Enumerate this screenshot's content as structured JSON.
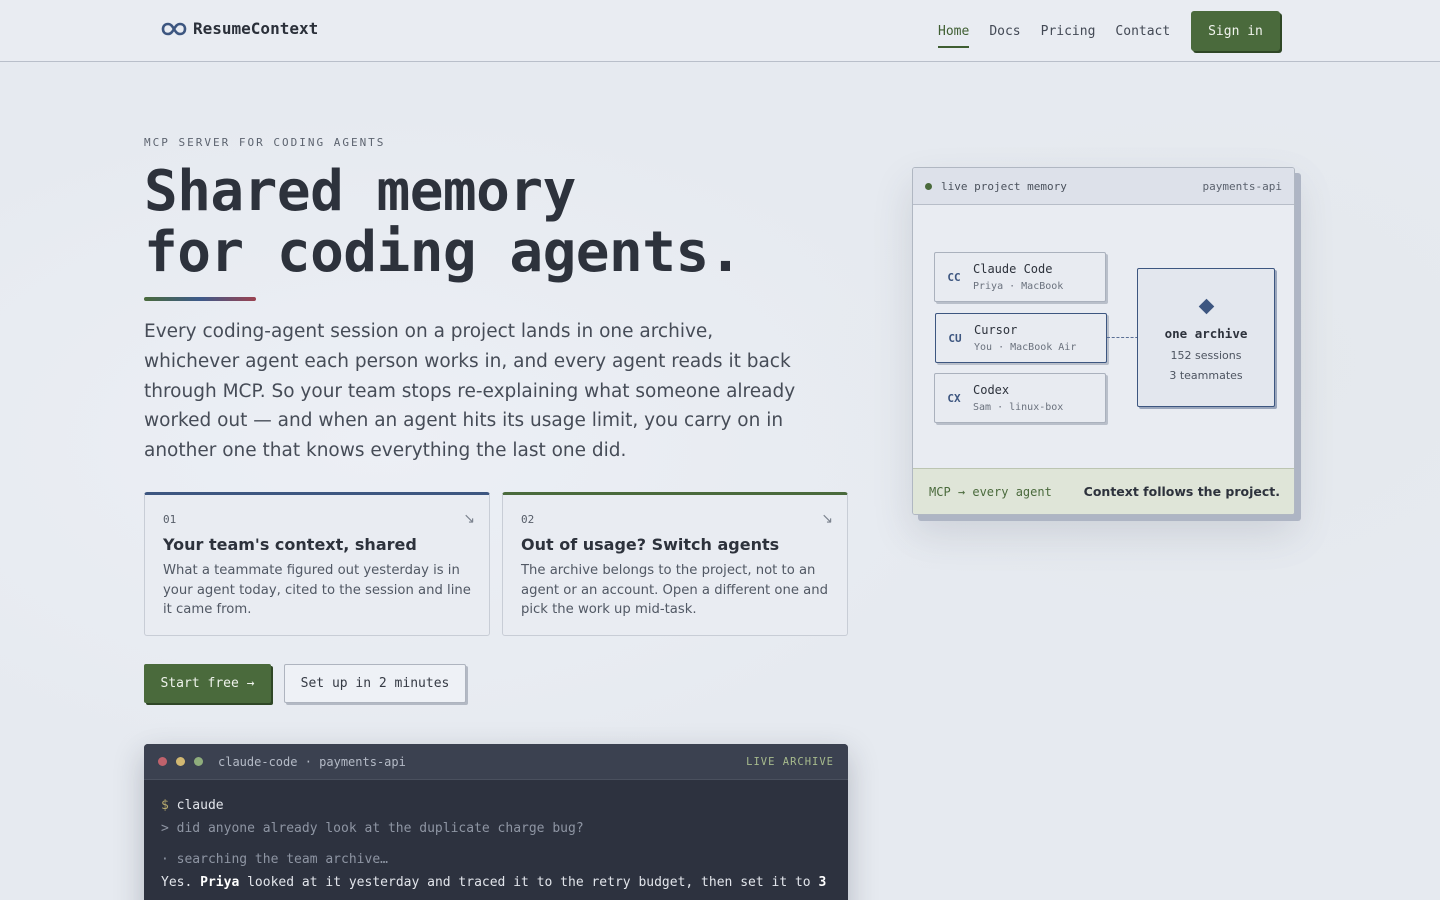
{
  "header": {
    "brand_name": "ResumeContext",
    "nav": [
      {
        "label": "Home",
        "active": true
      },
      {
        "label": "Docs"
      },
      {
        "label": "Pricing"
      },
      {
        "label": "Contact"
      }
    ],
    "signin_label": "Sign in"
  },
  "hero": {
    "eyebrow": "MCP SERVER FOR CODING AGENTS",
    "title_line1": "Shared memory",
    "title_line2": "for coding agents.",
    "lead": "Every coding-agent session on a project lands in one archive, whichever agent each person works in, and every agent reads it back through MCP. So your team stops re-explaining what someone already worked out — and when an agent hits its usage limit, you carry on in another one that knows everything the last one did."
  },
  "features": [
    {
      "num": "01",
      "title": "Your team's context, shared",
      "body": "What a teammate figured out yesterday is in your agent today, cited to the session and line it came from."
    },
    {
      "num": "02",
      "title": "Out of usage? Switch agents",
      "body": "The archive belongs to the project, not to an agent or an account. Open a different one and pick the work up mid-task."
    }
  ],
  "cta": {
    "primary": "Start free →",
    "secondary": "Set up in 2 minutes"
  },
  "terminal": {
    "title": "claude-code · payments-api",
    "badge": "LIVE ARCHIVE",
    "prompt_symbol": "$",
    "command": "claude",
    "question": "> did anyone already look at the duplicate charge bug?",
    "status": "· searching the team archive…",
    "answer_start": "Yes. ",
    "answer_name": "Priya",
    "answer_mid": " looked at it yesterday and traced it to the retry budget, then set it to ",
    "answer_value": "3"
  },
  "panel": {
    "label": "live project memory",
    "project": "payments-api",
    "agents": [
      {
        "abbr": "CC",
        "name": "Claude Code",
        "sub": "Priya · MacBook"
      },
      {
        "abbr": "CU",
        "name": "Cursor",
        "sub": "You · MacBook Air",
        "selected": true
      },
      {
        "abbr": "CX",
        "name": "Codex",
        "sub": "Sam · linux-box"
      }
    ],
    "archive_title": "one archive",
    "archive_sessions": "152 sessions",
    "archive_teammates": "3 teammates",
    "footer_left": "MCP → every agent",
    "footer_right": "Context follows the project."
  },
  "colors": {
    "accent_green": "#4a6a3c",
    "accent_blue": "#3d5680",
    "accent_red": "#9b4250",
    "terminal_bg": "#2d323f"
  },
  "icons": {
    "brand": "infinity-icon",
    "card_arrow": "arrow-down-right-icon",
    "archive": "diamond-icon"
  }
}
